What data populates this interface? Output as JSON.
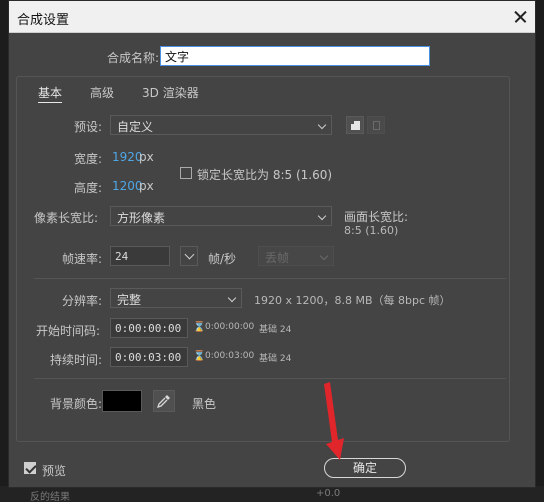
{
  "dialog": {
    "title": "合成设置",
    "comp_name_label": "合成名称:",
    "comp_name_value": "文字"
  },
  "tabs": [
    {
      "label": "基本",
      "active": true
    },
    {
      "label": "高级",
      "active": false
    },
    {
      "label": "3D 渲染器",
      "active": false
    }
  ],
  "basic": {
    "preset_label": "预设:",
    "preset_value": "自定义",
    "width_label": "宽度:",
    "width_value": "1920",
    "width_unit": "px",
    "height_label": "高度:",
    "height_value": "1200",
    "height_unit": "px",
    "lock_aspect_label": "锁定长宽比为 8:5 (1.60)",
    "lock_aspect_checked": false,
    "pixel_aspect_label": "像素长宽比:",
    "pixel_aspect_value": "方形像素",
    "frame_aspect_label": "画面长宽比:",
    "frame_aspect_value": "8:5 (1.60)",
    "frame_rate_label": "帧速率:",
    "frame_rate_value": "24",
    "frame_rate_unit": "帧/秒",
    "drop_frame_value": "丢帧",
    "resolution_label": "分辨率:",
    "resolution_value": "完整",
    "resolution_info": "1920 x 1200，8.8 MB（每 8bpc 帧）",
    "start_tc_label": "开始时间码:",
    "start_tc_value": "0:00:00:00",
    "start_tc_info": "0:00:00:00",
    "start_tc_base": "基础 24",
    "duration_label": "持续时间:",
    "duration_value": "0:00:03:00",
    "duration_info": "0:00:03:00",
    "duration_base": "基础 24",
    "bg_color_label": "背景颜色:",
    "bg_color_hex": "#000000",
    "bg_color_name": "黑色"
  },
  "footer": {
    "preview_label": "预览",
    "preview_checked": true,
    "ok_label": "确定"
  },
  "background": {
    "bottom_text_left": "反的结果",
    "bottom_text_right": "+0.0"
  },
  "colors": {
    "accent_blue": "#4ea6e6",
    "arrow_red": "#e0252b",
    "dialog_bg": "#444444"
  }
}
